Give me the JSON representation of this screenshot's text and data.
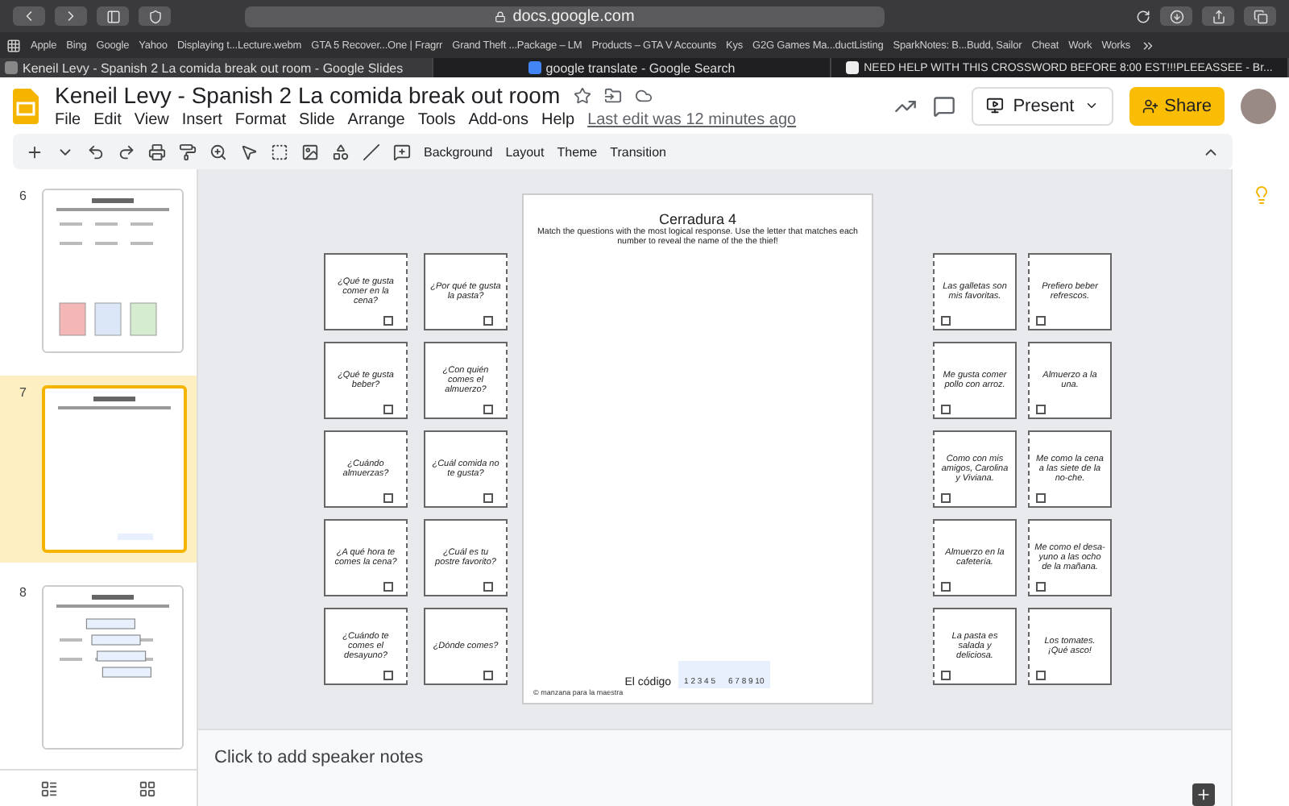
{
  "browser": {
    "url": "docs.google.com",
    "bookmarks": [
      "Apple",
      "Bing",
      "Google",
      "Yahoo",
      "Displaying t...Lecture.webm",
      "GTA 5 Recover...One | Fragrr",
      "Grand Theft ...Package – LM",
      "Products – GTA V Accounts",
      "Kys",
      "G2G Games Ma...ductListing",
      "SparkNotes: B...Budd, Sailor",
      "Cheat",
      "Work",
      "Works"
    ],
    "tabs": [
      {
        "title": "Keneil Levy - Spanish 2 La comida break out room - Google Slides",
        "selected": true
      },
      {
        "title": "google translate - Google Search",
        "selected": false
      },
      {
        "title": "NEED HELP WITH THIS CROSSWORD BEFORE 8:00 EST!!!PLEEASSEE - Br...",
        "selected": false
      }
    ]
  },
  "doc": {
    "title": "Keneil Levy - Spanish 2  La comida break out room",
    "menu": [
      "File",
      "Edit",
      "View",
      "Insert",
      "Format",
      "Slide",
      "Arrange",
      "Tools",
      "Add-ons",
      "Help"
    ],
    "last_edit": "Last edit was 12 minutes ago",
    "present": "Present",
    "share": "Share"
  },
  "toolbar": {
    "buttons": [
      "Background",
      "Layout",
      "Theme",
      "Transition"
    ]
  },
  "filmstrip": [
    {
      "number": "6",
      "selected": false
    },
    {
      "number": "7",
      "selected": true
    },
    {
      "number": "8",
      "selected": false
    }
  ],
  "slide": {
    "title": "Cerradura 4",
    "instructions": "Match the questions with the most logical response. Use the letter that matches each number to reveal the name of the the thief!",
    "code_label": "El código",
    "code_numbers": [
      "1 2 3 4 5",
      "6 7 8 9 10"
    ],
    "footer": "© manzana para la maestra"
  },
  "question_cards": [
    "¿Qué te gusta comer en la cena?",
    "¿Por qué te gusta la pasta?",
    "¿Qué te gusta beber?",
    "¿Con quién comes el almuerzo?",
    "¿Cuándo almuerzas?",
    "¿Cuál comida no te gusta?",
    "¿A qué hora te comes la cena?",
    "¿Cuál es tu postre favorito?",
    "¿Cuándo te comes el desayuno?",
    "¿Dónde comes?"
  ],
  "answer_cards": [
    "Las galletas son mis favoritas.",
    "Prefiero beber refrescos.",
    "Me gusta comer pollo con arroz.",
    "Almuerzo a la una.",
    "Como con mis amigos, Carolina y Viviana.",
    "Me como la cena a las siete de la no-che.",
    "Almuerzo en la cafetería.",
    "Me como el desa-yuno a las ocho de la mañana.",
    "La pasta es salada y deliciosa.",
    "Los tomates. ¡Qué asco!"
  ],
  "notes": {
    "placeholder": "Click to add speaker notes"
  }
}
